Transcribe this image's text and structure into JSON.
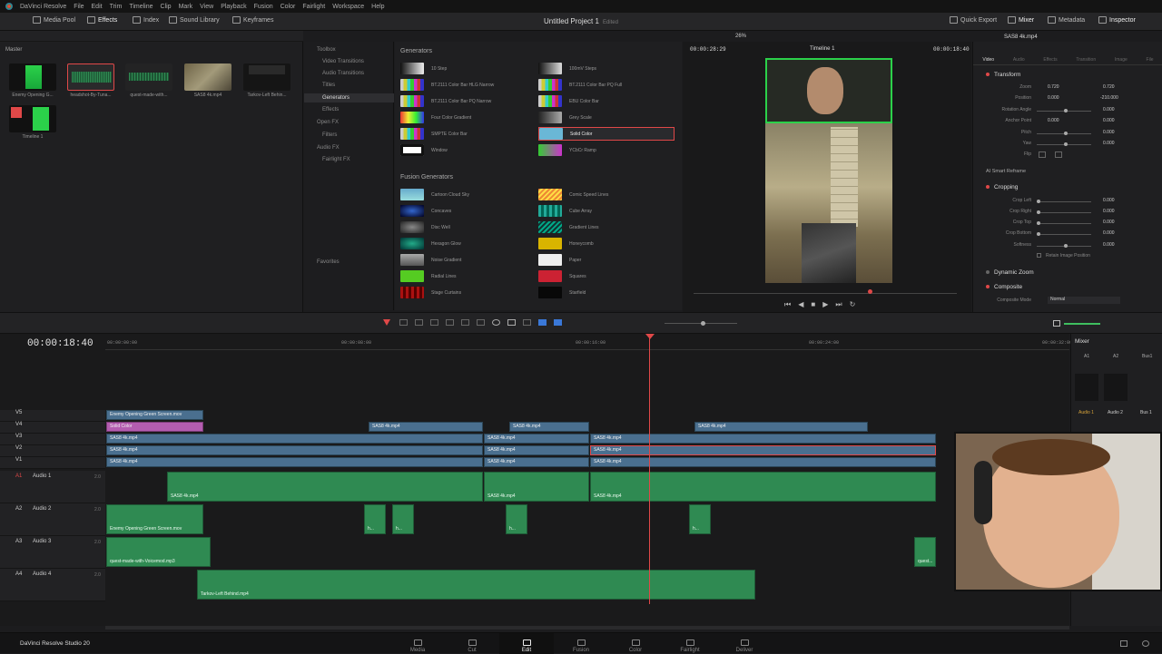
{
  "menubar": {
    "app": "DaVinci Resolve",
    "items": [
      "File",
      "Edit",
      "Trim",
      "Timeline",
      "Clip",
      "Mark",
      "View",
      "Playback",
      "Fusion",
      "Color",
      "Fairlight",
      "Workspace",
      "Help"
    ]
  },
  "toolbar": {
    "media_pool": "Media Pool",
    "effects": "Effects",
    "index": "Index",
    "sound_library": "Sound Library",
    "keyframes": "Keyframes",
    "project_title": "Untitled Project 1",
    "project_status": "Edited",
    "quick_export": "Quick Export",
    "mixer": "Mixer",
    "metadata": "Metadata",
    "inspector": "Inspector"
  },
  "mediapool": {
    "bin": "Master",
    "clips": [
      "Enemy Opening G...",
      "headshot-By-Tuna...",
      "quest-made-with...",
      "SAS8 4k.mp4",
      "Tarkov-Left Behin..."
    ],
    "timeline_item": "Timeline 1"
  },
  "effects_nav": {
    "toolbox": "Toolbox",
    "video_transitions": "Video Transitions",
    "audio_transitions": "Audio Transitions",
    "titles": "Titles",
    "generators": "Generators",
    "effects": "Effects",
    "openfx": "Open FX",
    "filters": "Filters",
    "audiofx": "Audio FX",
    "fairlight_fx": "Fairlight FX",
    "favorites": "Favorites"
  },
  "generators": {
    "header": "Generators",
    "items": [
      "10 Step",
      "100mV Steps",
      "BT.2111 Color Bar HLG Narrow",
      "BT.2111 Color Bar PQ Full",
      "BT.2111 Color Bar PQ Narrow",
      "EBU Color Bar",
      "Four Color Gradient",
      "Grey Scale",
      "SMPTE Color Bar",
      "Solid Color",
      "Window",
      "YCbCr Ramp"
    ]
  },
  "fusion_generators": {
    "header": "Fusion Generators",
    "items": [
      "Cartoon Cloud Sky",
      "Comic Speed Lines",
      "Concaves",
      "Cube Array",
      "Disc Well",
      "Gradient Lines",
      "Hexagon Glow",
      "Honeycomb",
      "Noise Gradient",
      "Paper",
      "Radial Lines",
      "Squares",
      "Stage Curtains",
      "Starfield"
    ]
  },
  "viewer": {
    "timecode_left": "00:00:28:29",
    "zoom": "26%",
    "timeline": "Timeline 1",
    "timecode_right": "00:00:18:40"
  },
  "inspector": {
    "clip": "SAS8 4k.mp4",
    "tabs": [
      "Video",
      "Audio",
      "Effects",
      "Transition",
      "Image",
      "File"
    ],
    "transform": "Transform",
    "zoom_label": "Zoom",
    "zoom_x": "0.720",
    "zoom_y": "0.720",
    "position_label": "Position",
    "pos_x": "0.000",
    "pos_y": "-210.000",
    "rotation_label": "Rotation Angle",
    "rotation": "0.000",
    "anchor_label": "Anchor Point",
    "anchor_x": "0.000",
    "anchor_y": "0.000",
    "pitch_label": "Pitch",
    "pitch": "0.000",
    "yaw_label": "Yaw",
    "yaw": "0.000",
    "flip_label": "Flip",
    "smart_reframe": "AI Smart Reframe",
    "cropping": "Cropping",
    "crop_left_label": "Crop Left",
    "crop_left": "0.000",
    "crop_right_label": "Crop Right",
    "crop_right": "0.000",
    "crop_top_label": "Crop Top",
    "crop_top": "0.000",
    "crop_bottom_label": "Crop Bottom",
    "crop_bottom": "0.000",
    "softness_label": "Softness",
    "softness": "0.000",
    "retain": "Retain Image Position",
    "dynamic_zoom": "Dynamic Zoom",
    "composite": "Composite",
    "composite_mode_label": "Composite Mode",
    "composite_mode": "Normal"
  },
  "timeline": {
    "timecode": "00:00:18:40",
    "ruler": [
      "00:00:00:00",
      "00:00:08:00",
      "00:00:16:00",
      "00:00:24:00",
      "00:00:32:00"
    ],
    "tracks": [
      {
        "id": "V5",
        "name": ""
      },
      {
        "id": "V4",
        "name": ""
      },
      {
        "id": "V3",
        "name": ""
      },
      {
        "id": "V2",
        "name": ""
      },
      {
        "id": "V1",
        "name": ""
      },
      {
        "id": "A1",
        "name": "Audio 1",
        "ch": "2.0"
      },
      {
        "id": "A2",
        "name": "Audio 2",
        "ch": "2.0"
      },
      {
        "id": "A3",
        "name": "Audio 3",
        "ch": "2.0"
      },
      {
        "id": "A4",
        "name": "Audio 4",
        "ch": "2.0"
      }
    ],
    "clips": {
      "v5": "Enemy Opening Green Screen.mov",
      "v4_solid": "Solid Color",
      "sas": "SAS8 4k.mp4",
      "a2a": "Enemy Opening Green Screen.mov",
      "a3": "quest-made-with-Voicemod.mp3",
      "a3b": "quest...",
      "a4": "Tarkov-Left Behind.mp4",
      "h": "h..."
    }
  },
  "mixer": {
    "title": "Mixer",
    "ch": [
      "A1",
      "A2",
      "Bus1"
    ],
    "names": [
      "Audio 1",
      "Audio 2",
      "Bus 1"
    ]
  },
  "pages": {
    "brand": "DaVinci Resolve Studio 20",
    "items": [
      "Media",
      "Cut",
      "Edit",
      "Fusion",
      "Color",
      "Fairlight",
      "Deliver"
    ],
    "active": "Edit"
  }
}
